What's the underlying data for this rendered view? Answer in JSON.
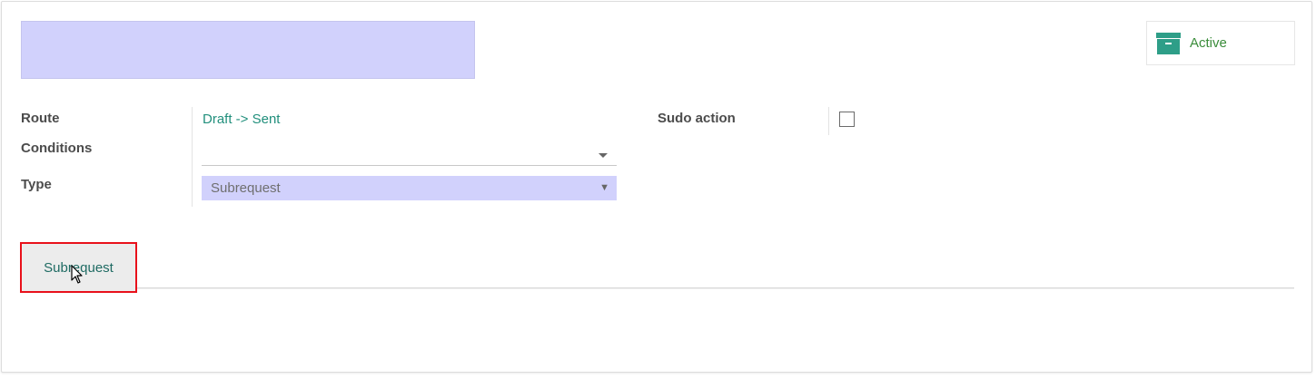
{
  "header": {
    "smart_button_label": "Active"
  },
  "form": {
    "route_label": "Route",
    "route_value": "Draft -> Sent",
    "conditions_label": "Conditions",
    "conditions_value": "",
    "type_label": "Type",
    "type_value": "Subrequest",
    "sudo_label": "Sudo action",
    "sudo_checked": false
  },
  "tabs": {
    "subrequest_label": "Subrequest"
  },
  "icons": {
    "smart_button": "archive-box-icon",
    "dropdown": "caret-down-icon",
    "cursor": "mouse-pointer-icon"
  },
  "colors": {
    "accent": "#218f7c",
    "active_label": "#3a8c3a",
    "highlight_field": "#d1d1fc",
    "tab_outline": "#e8111b"
  }
}
